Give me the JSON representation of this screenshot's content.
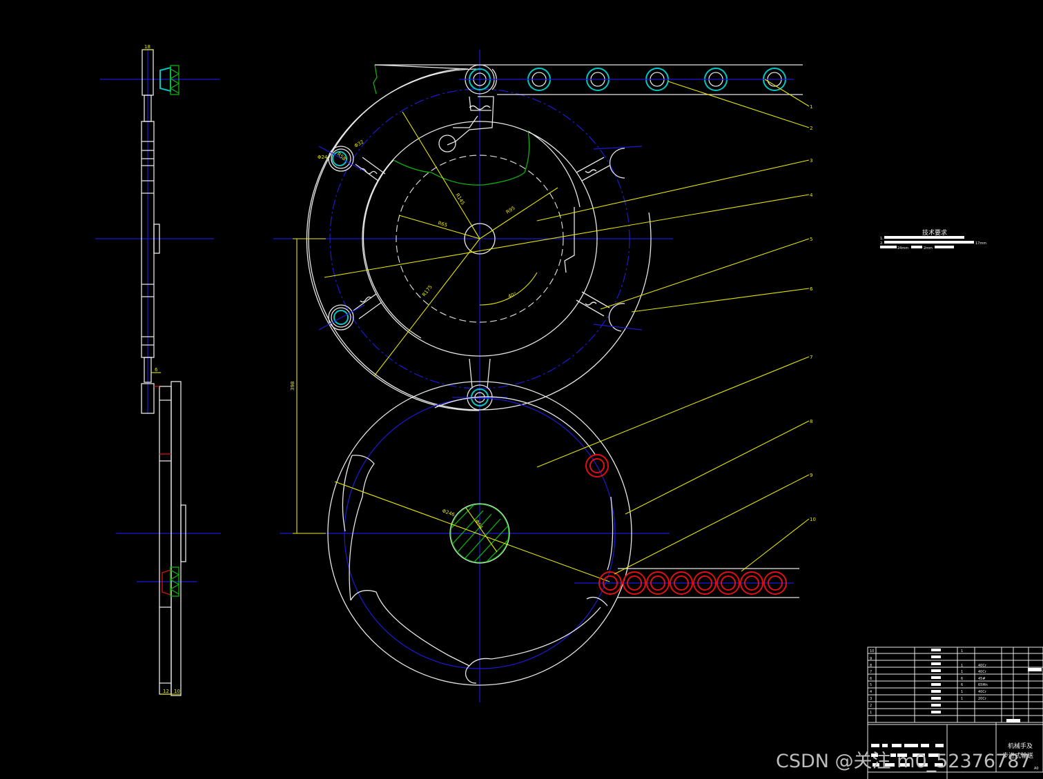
{
  "drawing": {
    "tech_requirements_title": "技术要求",
    "tech_requirements": [
      {
        "index": "1.",
        "text": "17mm"
      },
      {
        "index": "2.",
        "text": "24mm"
      },
      {
        "index": "",
        "text": "2mm"
      }
    ],
    "dimensions": {
      "r_top_inner": "R65",
      "r_top_mid": "R95",
      "r_top_outer": "R145",
      "r_sweep": "R175",
      "r_hole": "R58",
      "angle": "40°",
      "phi_small": "Φ24",
      "phi_pin": "Φ32",
      "center_distance": "398",
      "phi_bottom": "Φ246",
      "phi_shaft": "Φ64",
      "side_width_top": "18",
      "side_gap": "6",
      "side_w1": "12",
      "side_w2": "10"
    },
    "part_callouts": [
      "1",
      "2",
      "3",
      "4",
      "5",
      "6",
      "7",
      "8",
      "9",
      "10"
    ],
    "title_block": {
      "rows": [
        {
          "no": "10",
          "qty": "1",
          "material": ""
        },
        {
          "no": "9",
          "qty": "",
          "material": ""
        },
        {
          "no": "8",
          "qty": "1",
          "material": "40Cr"
        },
        {
          "no": "7",
          "qty": "1",
          "material": "40Cr"
        },
        {
          "no": "6",
          "qty": "6",
          "material": "45#"
        },
        {
          "no": "5",
          "qty": "6",
          "material": "65Mn"
        },
        {
          "no": "4",
          "qty": "1",
          "material": "40Cr"
        },
        {
          "no": "3",
          "qty": "1",
          "material": "20Cr"
        },
        {
          "no": "2",
          "qty": "",
          "material": ""
        },
        {
          "no": "1",
          "qty": "",
          "material": ""
        }
      ],
      "title_line1": "机械手及",
      "title_line2": "步进式输送",
      "sheet_size": "A0"
    },
    "watermark": "CSDN @关注 m0_52376787"
  }
}
